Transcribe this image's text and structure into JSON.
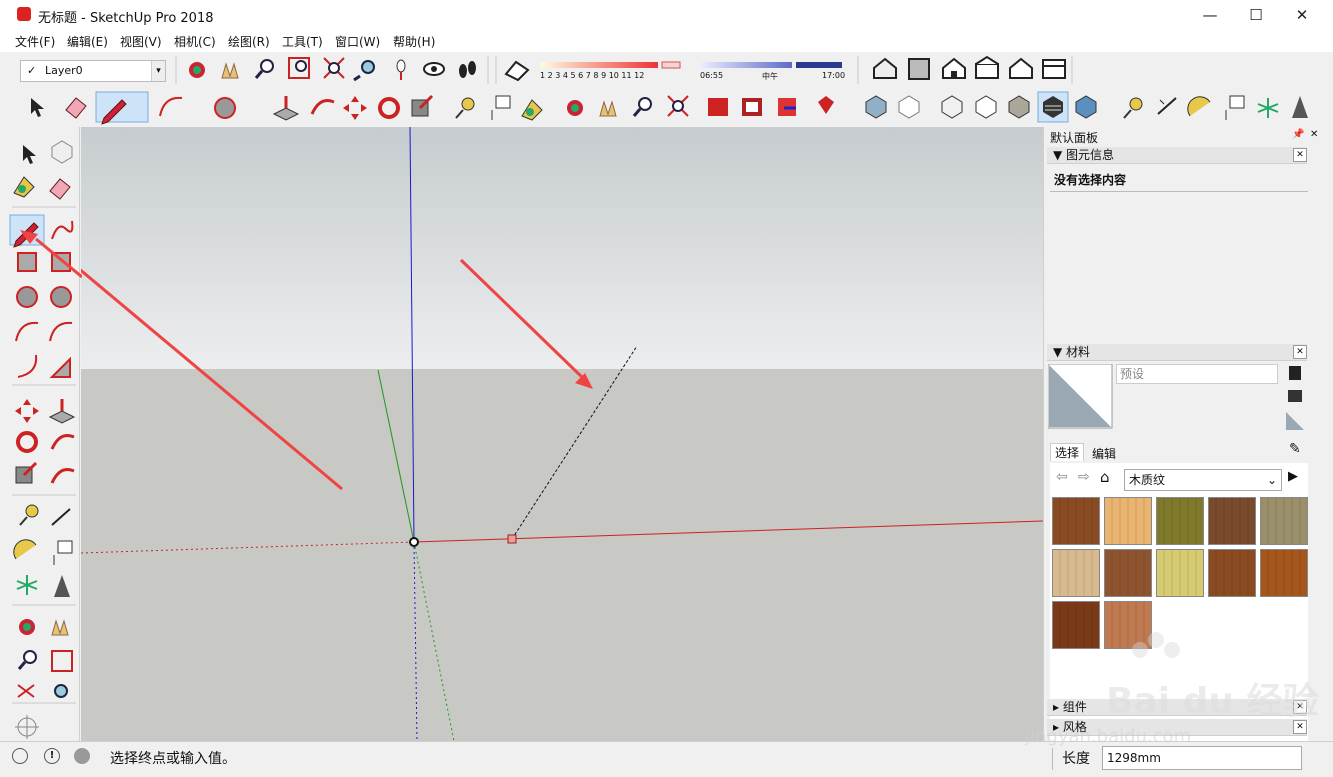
{
  "window": {
    "title": "无标题 - SketchUp Pro 2018",
    "minimize": "—",
    "maximize": "☐",
    "close": "✕"
  },
  "menu": [
    "文件(F)",
    "编辑(E)",
    "视图(V)",
    "相机(C)",
    "绘图(R)",
    "工具(T)",
    "窗口(W)",
    "帮助(H)"
  ],
  "layer": {
    "check": "✓",
    "name": "Layer0",
    "arrow": "▾"
  },
  "shadow": {
    "months": "1  2  3  4  5  6  7  8  9  10 11 12",
    "time_start": "06:55",
    "time_mid": "中午",
    "time_end": "17:00"
  },
  "panel": {
    "title": "默认面板",
    "pin": "📌",
    "close": "✕",
    "entity_info": {
      "header": "▼ 图元信息",
      "empty": "没有选择内容"
    },
    "materials": {
      "header": "▼ 材料",
      "preset_placeholder": "预设",
      "tab_select": "选择",
      "tab_edit": "编辑",
      "library": "木质纹",
      "library_arrow": "⌄"
    },
    "components": {
      "header": "▸ 组件"
    },
    "styles": {
      "header": "▸ 风格"
    },
    "swatch_colors": [
      "#8a4a22",
      "#e9b571",
      "#7f7a2b",
      "#7a4a2c",
      "#9a8f6a",
      "#d8ba8e",
      "#8e5430",
      "#d6cb72",
      "#8b4b22",
      "#a4561c",
      "#7a3a18",
      "#c07a52"
    ]
  },
  "status": {
    "text": "选择终点或输入值。",
    "length_label": "长度",
    "length_value": "1298mm"
  },
  "watermark": {
    "brand": "Bai  du 经验",
    "url": "jingyan.baidu.com"
  },
  "colors": {
    "axis_red": "#cc2222",
    "axis_green": "#1a9a1a",
    "axis_blue": "#1a1acc",
    "arrow": "#ee4444"
  }
}
